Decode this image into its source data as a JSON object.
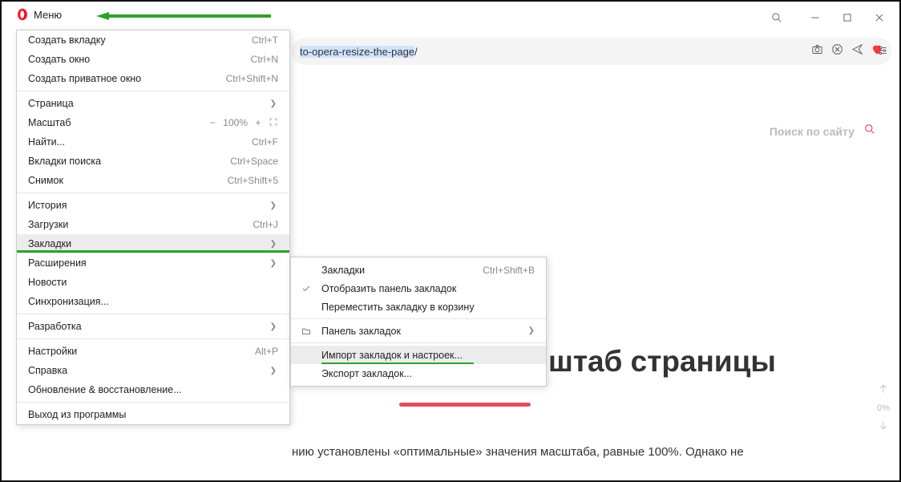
{
  "menu_button": "Меню",
  "address_bar": {
    "url_suffix": "to-opera-resize-the-page",
    "url_slash": "/"
  },
  "main_menu": {
    "items": [
      {
        "label": "Создать вкладку",
        "shortcut": "Ctrl+T"
      },
      {
        "label": "Создать окно",
        "shortcut": "Ctrl+N"
      },
      {
        "label": "Создать приватное окно",
        "shortcut": "Ctrl+Shift+N"
      }
    ],
    "page": "Страница",
    "zoom_label": "Масштаб",
    "zoom_minus": "−",
    "zoom_value": "100%",
    "zoom_plus": "+",
    "find": {
      "label": "Найти...",
      "shortcut": "Ctrl+F"
    },
    "search_tabs": {
      "label": "Вкладки поиска",
      "shortcut": "Ctrl+Space"
    },
    "snapshot": {
      "label": "Снимок",
      "shortcut": "Ctrl+Shift+5"
    },
    "history": "История",
    "downloads": {
      "label": "Загрузки",
      "shortcut": "Ctrl+J"
    },
    "bookmarks": "Закладки",
    "extensions": "Расширения",
    "news": "Новости",
    "sync": "Синхронизация...",
    "dev": "Разработка",
    "settings": {
      "label": "Настройки",
      "shortcut": "Alt+P"
    },
    "help": "Справка",
    "update": "Обновление & восстановление...",
    "exit": "Выход из программы"
  },
  "submenu": {
    "bookmarks": {
      "label": "Закладки",
      "shortcut": "Ctrl+Shift+B"
    },
    "show_bar": "Отобразить панель закладок",
    "to_trash": "Переместить закладку в корзину",
    "bar": "Панель закладок",
    "import": "Импорт закладок и настроек...",
    "export": "Экспорт закладок..."
  },
  "page": {
    "search_placeholder": "Поиск по сайту",
    "headline_fragment": "штаб страницы",
    "body_fragment": "нию установлены «оптимальные» значения масштаба, равные 100%. Однако не",
    "zoom_pct": "0%"
  }
}
